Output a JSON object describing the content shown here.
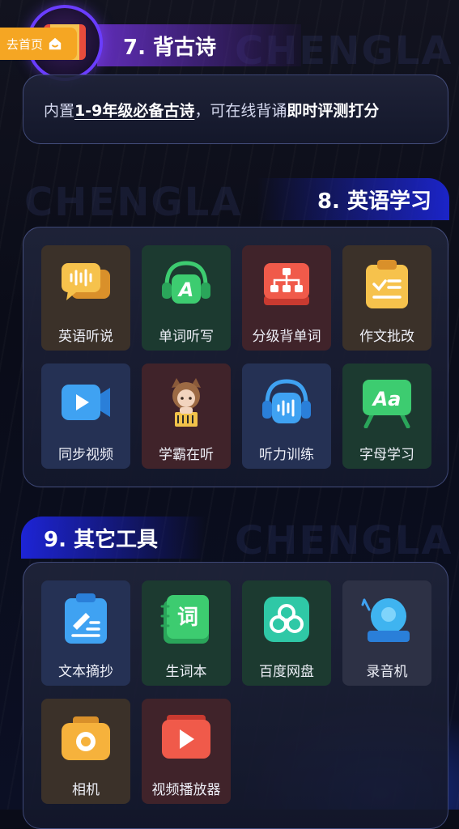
{
  "home_button": {
    "label": "去首页"
  },
  "watermark": "CHENGLA",
  "section7": {
    "title": "7. 背古诗",
    "desc_prefix": "内置",
    "desc_underlined": "1-9年级必备古诗",
    "desc_mid": "，可在线背诵",
    "desc_highlight": "即时评测打分"
  },
  "section8": {
    "title": "8. 英语学习",
    "items": [
      {
        "label": "英语听说",
        "icon": "speech-bubbles-icon"
      },
      {
        "label": "单词听写",
        "icon": "headphones-letter-a-icon"
      },
      {
        "label": "分级背单词",
        "icon": "hierarchy-icon"
      },
      {
        "label": "作文批改",
        "icon": "clipboard-check-icon"
      },
      {
        "label": "同步视频",
        "icon": "video-camera-icon"
      },
      {
        "label": "学霸在听",
        "icon": "cartoon-girl-icon"
      },
      {
        "label": "听力训练",
        "icon": "headphones-soundwave-icon"
      },
      {
        "label": "字母学习",
        "icon": "chalkboard-aa-icon"
      }
    ]
  },
  "section9": {
    "title": "9. 其它工具",
    "items": [
      {
        "label": "文本摘抄",
        "icon": "note-pen-icon"
      },
      {
        "label": "生词本",
        "icon": "vocabulary-book-icon",
        "glyph": "词"
      },
      {
        "label": "百度网盘",
        "icon": "cloud-drive-icon"
      },
      {
        "label": "录音机",
        "icon": "bell-recorder-icon"
      },
      {
        "label": "相机",
        "icon": "camera-icon"
      },
      {
        "label": "视频播放器",
        "icon": "video-player-icon"
      }
    ]
  },
  "colors": {
    "accent_blue": "#1d24d6",
    "home_orange": "#f5a623",
    "badge_purple": "#6a3dff"
  }
}
